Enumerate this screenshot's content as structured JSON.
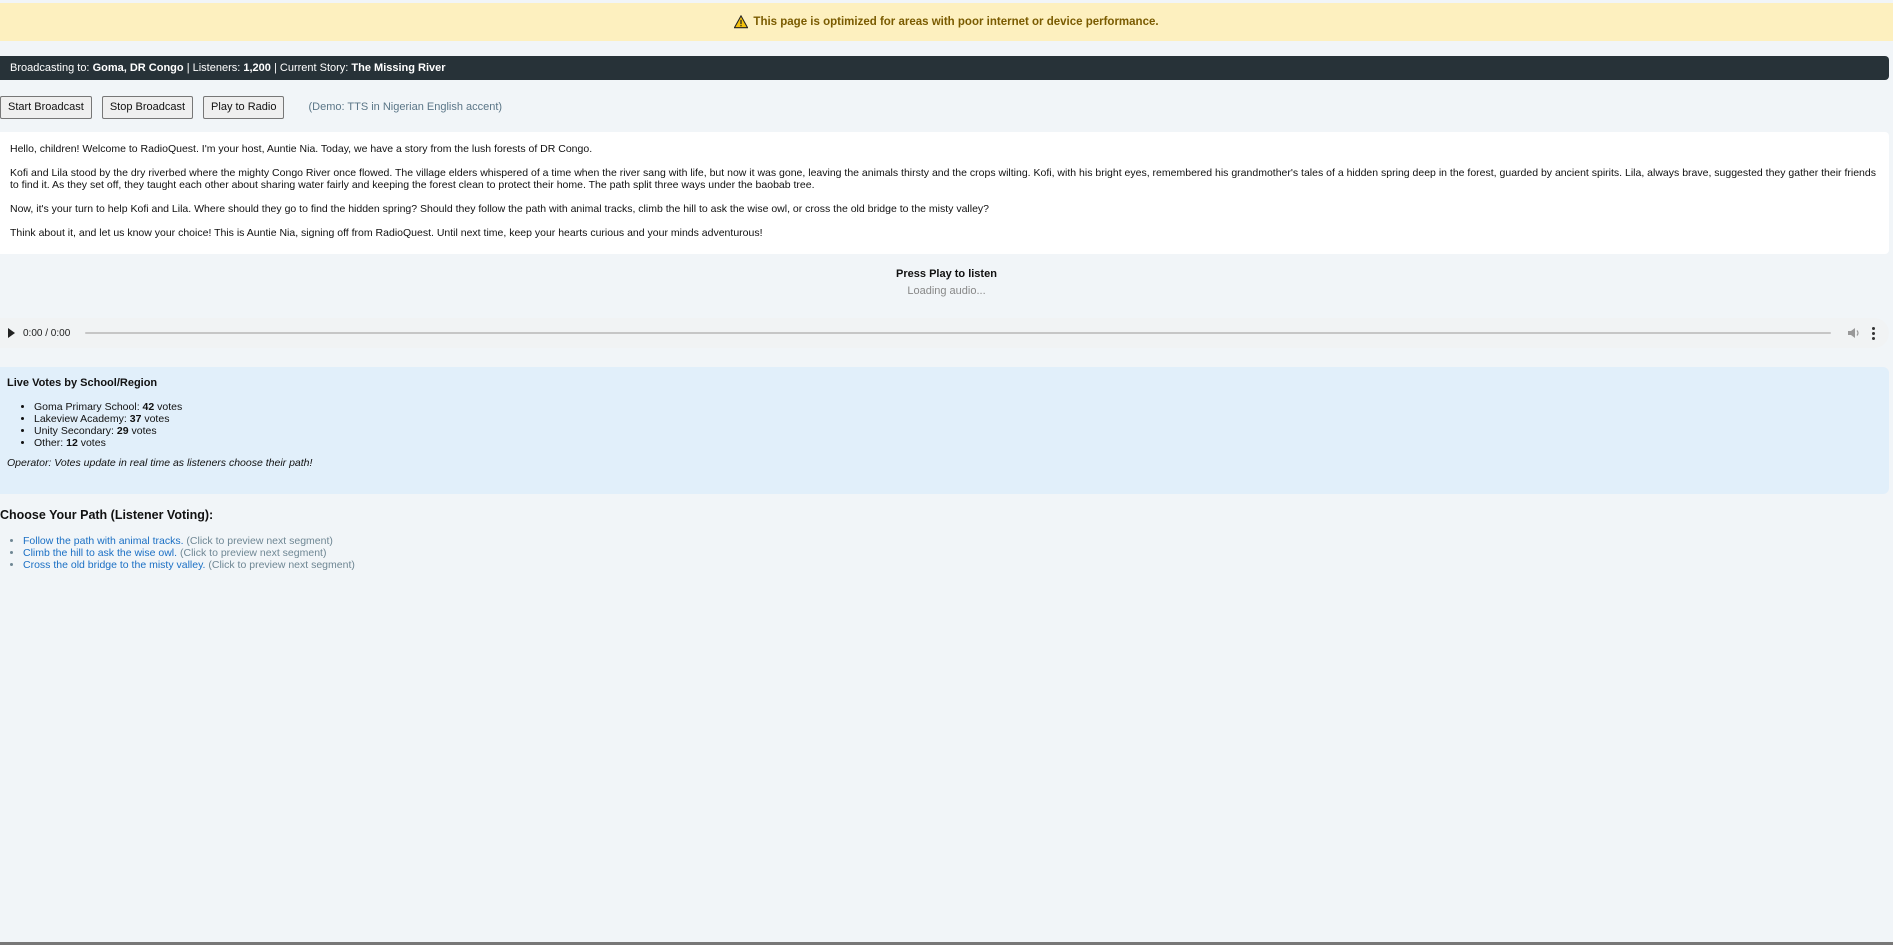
{
  "banner": {
    "text": "This page is optimized for areas with poor internet or device performance.",
    "icon": "warning-icon"
  },
  "status": {
    "broadcasting_label": "Broadcasting to:",
    "location": "Goma, DR Congo",
    "listeners_label": "Listeners:",
    "listeners": "1,200",
    "story_label": "Current Story:",
    "story": "The Missing River",
    "sep": "|"
  },
  "controls": {
    "start": "Start Broadcast",
    "stop": "Stop Broadcast",
    "play": "Play to Radio",
    "demo_note": "(Demo: TTS in Nigerian English accent)"
  },
  "story": {
    "paragraphs": [
      "Hello, children! Welcome to RadioQuest. I'm your host, Auntie Nia. Today, we have a story from the lush forests of DR Congo.",
      "Kofi and Lila stood by the dry riverbed where the mighty Congo River once flowed. The village elders whispered of a time when the river sang with life, but now it was gone, leaving the animals thirsty and the crops wilting. Kofi, with his bright eyes, remembered his grandmother's tales of a hidden spring deep in the forest, guarded by ancient spirits. Lila, always brave, suggested they gather their friends to find it. As they set off, they taught each other about sharing water fairly and keeping the forest clean to protect their home. The path split three ways under the baobab tree.",
      "Now, it's your turn to help Kofi and Lila. Where should they go to find the hidden spring? Should they follow the path with animal tracks, climb the hill to ask the wise owl, or cross the old bridge to the misty valley?",
      "Think about it, and let us know your choice! This is Auntie Nia, signing off from RadioQuest. Until next time, keep your hearts curious and your minds adventurous!"
    ]
  },
  "player": {
    "press_play": "Press Play to listen",
    "loading": "Loading audio...",
    "time": "0:00 / 0:00"
  },
  "votes": {
    "title": "Live Votes by School/Region",
    "items": [
      {
        "name": "Goma Primary School:",
        "count": "42",
        "unit": "votes"
      },
      {
        "name": "Lakeview Academy:",
        "count": "37",
        "unit": "votes"
      },
      {
        "name": "Unity Secondary:",
        "count": "29",
        "unit": "votes"
      },
      {
        "name": "Other:",
        "count": "12",
        "unit": "votes"
      }
    ],
    "operator_note": "Operator: Votes update in real time as listeners choose their path!"
  },
  "choose": {
    "title": "Choose Your Path (Listener Voting):",
    "options": [
      {
        "label": "Follow the path with animal tracks.",
        "hint": "(Click to preview next segment)"
      },
      {
        "label": "Climb the hill to ask the wise owl.",
        "hint": "(Click to preview next segment)"
      },
      {
        "label": "Cross the old bridge to the misty valley.",
        "hint": "(Click to preview next segment)"
      }
    ]
  },
  "colors": {
    "banner_bg": "#fdf0bf",
    "status_bg": "#273238",
    "votes_bg": "#e1effa",
    "link": "#1a6fc4"
  }
}
